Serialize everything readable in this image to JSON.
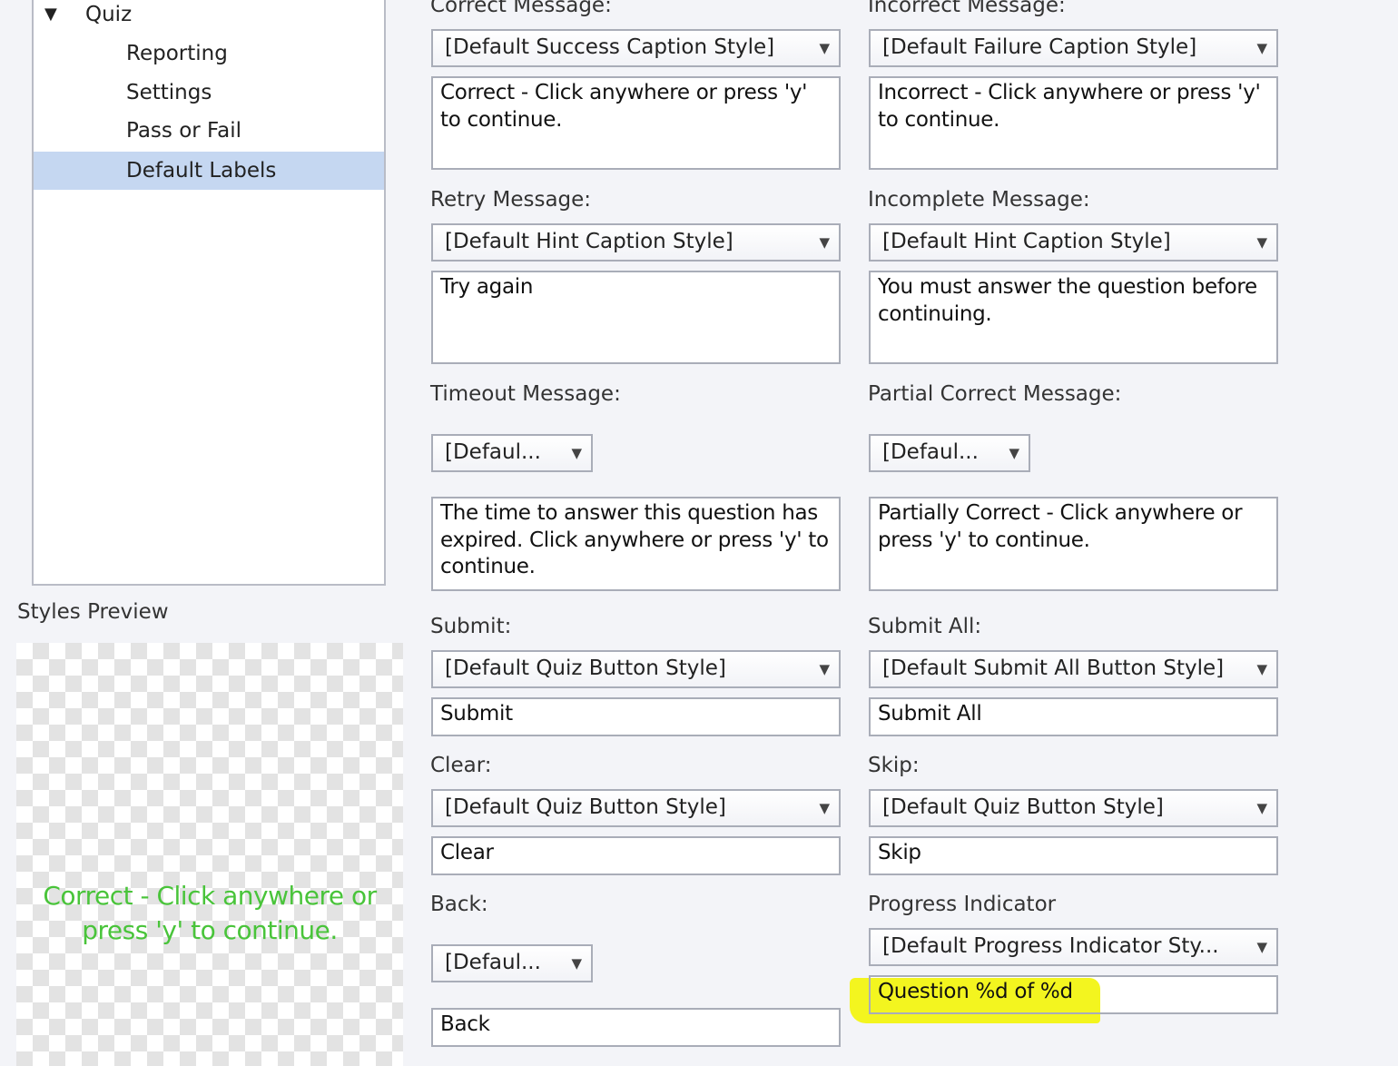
{
  "tree": {
    "items": [
      {
        "label": "Quiz",
        "expanded": true
      },
      {
        "label": "Reporting"
      },
      {
        "label": "Settings"
      },
      {
        "label": "Pass or Fail"
      },
      {
        "label": "Default Labels",
        "selected": true
      }
    ],
    "expand_icon": "triangle-down-icon"
  },
  "preview": {
    "label": "Styles Preview",
    "text_line1": "Correct - Click anywhere or",
    "text_line2": "press 'y' to continue.",
    "text_color": "#49c43a"
  },
  "fields": {
    "correct": {
      "label": "Correct Message:",
      "style": "[Default Success Caption Style]",
      "text": "Correct - Click anywhere or press 'y' to continue."
    },
    "incorrect": {
      "label": "Incorrect Message:",
      "style": "[Default Failure Caption Style]",
      "text": "Incorrect - Click anywhere or press 'y' to continue."
    },
    "retry": {
      "label": "Retry Message:",
      "style": "[Default Hint Caption Style]",
      "text": "Try again"
    },
    "incomplete": {
      "label": "Incomplete Message:",
      "style": "[Default Hint Caption Style]",
      "text": "You must answer the question before continuing."
    },
    "timeout": {
      "label": "Timeout Message:",
      "style": "[Defaul...",
      "text": "The time to answer this question has expired. Click anywhere or press 'y' to continue."
    },
    "partial": {
      "label": "Partial Correct Message:",
      "style": "[Defaul...",
      "text": "Partially Correct - Click anywhere or press 'y' to continue."
    },
    "submit": {
      "label": "Submit:",
      "style": "[Default Quiz Button Style]",
      "text": "Submit"
    },
    "submit_all": {
      "label": "Submit All:",
      "style": "[Default Submit All Button Style]",
      "text": "Submit All"
    },
    "clear": {
      "label": "Clear:",
      "style": "[Default Quiz Button Style]",
      "text": "Clear"
    },
    "skip": {
      "label": "Skip:",
      "style": "[Default Quiz Button Style]",
      "text": "Skip"
    },
    "back": {
      "label": "Back:",
      "style": "[Defaul...",
      "text": "Back"
    },
    "progress": {
      "label": "Progress Indicator",
      "style": "[Default Progress Indicator Sty...",
      "text": "Question %d of %d"
    }
  },
  "colors": {
    "selection": "#c5d7f1",
    "highlight": "#f3f51f",
    "border": "#a9adb8"
  },
  "dropdown_icon": "triangle-down-icon"
}
